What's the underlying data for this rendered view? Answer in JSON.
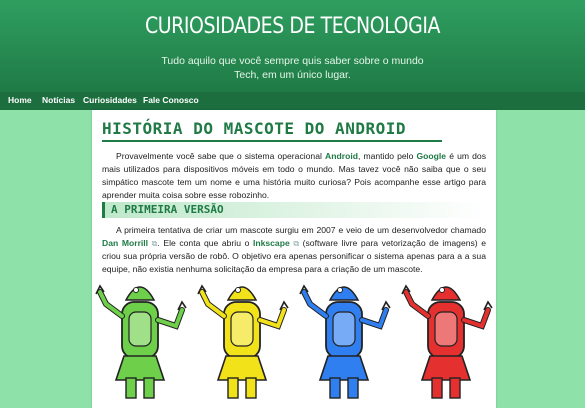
{
  "site": {
    "title": "Curiosidades de Tecnologia",
    "tagline": "Tudo aquilo que você sempre quis saber sobre o mundo Tech, em um único lugar."
  },
  "nav": {
    "items": [
      "Home",
      "Notícias",
      "Curiosidades",
      "Fale Conosco"
    ]
  },
  "post": {
    "title": "História do mascote do Android",
    "intro": {
      "t1": "Provavelmente você sabe que o sistema operacional ",
      "android": "Android",
      "t2": ", mantido pelo ",
      "google": "Google",
      "t3": " é um dos mais utilizados para dispositivos móveis em todo o mundo. Mas tavez você não saiba que o seu simpático mascote tem um nome e uma história muito curiosa? Pois acompanhe esse artigo para aprender muita coisa sobre esse robozinho."
    },
    "section1": {
      "heading": "A primeira versão",
      "t1": "A primeira tentativa de criar um mascote surgiu em 2007 e veio de um desenvolvedor chamado ",
      "dan": "Dan Morrill",
      "t2": ". Ele conta que abriu o ",
      "inkscape": "Inkscape",
      "t3": " (software livre para vetorização de imagens) e criou sua própria versão de robô. O objetivo era apenas personificar o sistema apenas para a a sua equipe, não existia nenhuma solicitação da empresa para a criação de um mascote."
    },
    "robot_colors": [
      "#6ed04a",
      "#f2e21a",
      "#2f7ff0",
      "#e53030"
    ]
  },
  "colors": {
    "accent": "#1f7a45",
    "background": "#8ee2a9"
  }
}
